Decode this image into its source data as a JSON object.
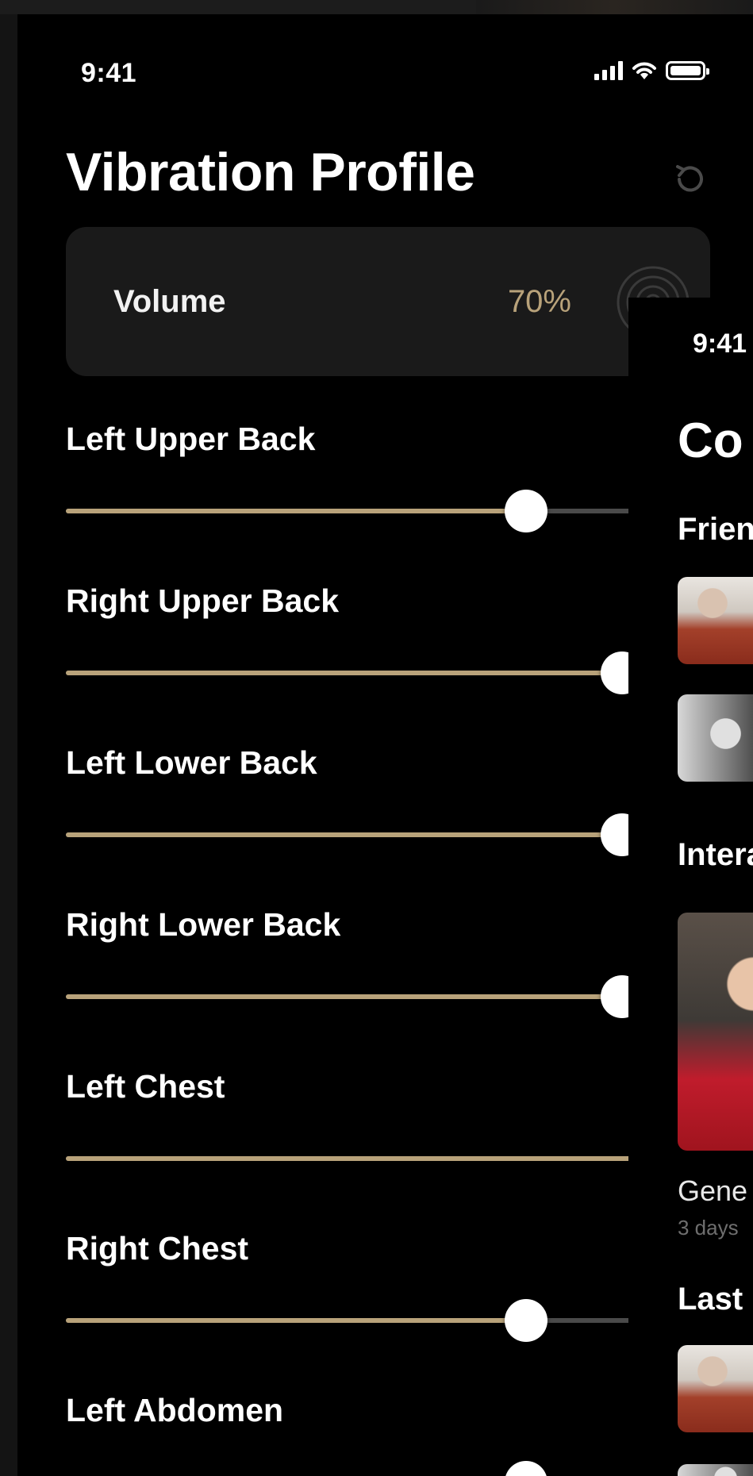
{
  "status": {
    "time": "9:41"
  },
  "header": {
    "title": "Vibration Profile",
    "reset_icon": "reset-icon"
  },
  "volume": {
    "label": "Volume",
    "value": "70%"
  },
  "sliders": [
    {
      "label": "Left Upper Back",
      "value_percent": 67
    },
    {
      "label": "Right Upper Back",
      "value_percent": 81
    },
    {
      "label": "Left Lower Back",
      "value_percent": 81
    },
    {
      "label": "Right Lower Back",
      "value_percent": 81
    },
    {
      "label": "Left Chest",
      "value_percent": 90
    },
    {
      "label": "Right Chest",
      "value_percent": 67
    },
    {
      "label": "Left Abdomen",
      "value_percent": 67
    }
  ],
  "secondary_screen": {
    "time": "9:41",
    "title": "Co",
    "sections": [
      "Frien",
      "Intera",
      "Last"
    ],
    "post_name": "Gene",
    "post_time": "3 days"
  },
  "colors": {
    "accent": "#b8a27a",
    "track": "#4a4a4a",
    "background": "#000000",
    "card": "#1a1a1a"
  }
}
